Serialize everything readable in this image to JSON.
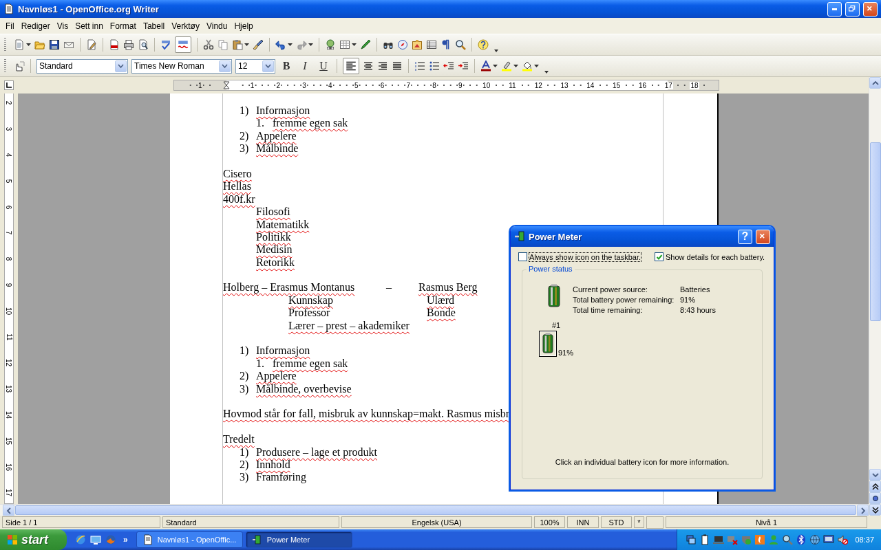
{
  "window": {
    "title": "Navnløs1 - OpenOffice.org Writer"
  },
  "menu": [
    "Fil",
    "Rediger",
    "Vis",
    "Sett inn",
    "Format",
    "Tabell",
    "Verktøy",
    "Vindu",
    "Hjelp"
  ],
  "standard_bar": {
    "auto_spellcheck": true
  },
  "format_bar": {
    "paragraph_style": "Standard",
    "font": "Times New Roman",
    "size": "12",
    "bold": "B",
    "italic": "I",
    "underline": "U",
    "align": [
      {
        "selected": true
      },
      {
        "selected": false
      },
      {
        "selected": false
      },
      {
        "selected": false
      }
    ]
  },
  "ruler": {
    "marks": [
      "1",
      "1",
      "2",
      "3",
      "4",
      "5",
      "6",
      "7",
      "8",
      "9",
      "10",
      "11",
      "12",
      "13",
      "14",
      "15",
      "16",
      "17",
      "18"
    ]
  },
  "vertical_ruler": {
    "marks": [
      "2",
      "3",
      "4",
      "5",
      "6",
      "7",
      "8",
      "9",
      "10",
      "11",
      "12",
      "13",
      "14",
      "15",
      "16",
      "17"
    ]
  },
  "document": {
    "lines": [
      {
        "kind": "numbered",
        "marker": "1)",
        "text": "Informasjon",
        "flagged": true
      },
      {
        "kind": "sub",
        "marker": "1.",
        "text": "fremme egen sak",
        "flagged": true
      },
      {
        "kind": "numbered",
        "marker": "2)",
        "text": "Appelere",
        "flagged": true
      },
      {
        "kind": "numbered",
        "marker": "3)",
        "text": "Målbinde",
        "flagged": true
      },
      {
        "kind": "blank"
      },
      {
        "kind": "text",
        "text": "Cisero",
        "flagged": true
      },
      {
        "kind": "text",
        "text": "Hellas",
        "flagged": true
      },
      {
        "kind": "text",
        "text": "400f.kr",
        "flagged": true
      },
      {
        "kind": "indent",
        "text": "Filosofi",
        "flagged": true
      },
      {
        "kind": "indent",
        "text": "Matematikk",
        "flagged": true
      },
      {
        "kind": "indent",
        "text": "Politikk",
        "flagged": true
      },
      {
        "kind": "indent",
        "text": "Medisin",
        "flagged": true
      },
      {
        "kind": "indent",
        "text": "Retorikk",
        "flagged": true
      },
      {
        "kind": "blank"
      },
      {
        "kind": "columns",
        "cells": [
          {
            "text": "Holberg – Erasmus Montanus",
            "flagged": true
          },
          {
            "text": "–"
          },
          {
            "text": "Rasmus Berg",
            "flagged": true
          }
        ]
      },
      {
        "kind": "pair",
        "cells": [
          {
            "text": "Kunnskap",
            "flagged": true
          },
          {
            "text": "Ulærd",
            "flagged": true
          }
        ]
      },
      {
        "kind": "pair",
        "cells": [
          {
            "text": "Professor",
            "flagged": false
          },
          {
            "text": "Bonde",
            "flagged": true
          }
        ]
      },
      {
        "kind": "indent2",
        "text": "Lærer – prest – akademiker",
        "flagged": true
      },
      {
        "kind": "blank"
      },
      {
        "kind": "numbered",
        "marker": "1)",
        "text": "Informasjon",
        "flagged": true
      },
      {
        "kind": "sub",
        "marker": "1.",
        "text": "fremme egen sak",
        "flagged": true
      },
      {
        "kind": "numbered",
        "marker": "2)",
        "text": "Appelere",
        "flagged": true
      },
      {
        "kind": "numbered",
        "marker": "3)",
        "text": "Målbinde, overbevise",
        "flagged": true
      },
      {
        "kind": "blank"
      },
      {
        "kind": "text",
        "text": "Hovmod står for fall, misbruk av kunnskap=makt. Rasmus misbr",
        "flagged": true
      },
      {
        "kind": "blank"
      },
      {
        "kind": "text",
        "text": "Tredelt",
        "flagged": true
      },
      {
        "kind": "numbered",
        "marker": "1)",
        "text": "Produsere – lage et produkt",
        "flagged": true
      },
      {
        "kind": "numbered",
        "marker": "2)",
        "text": "Innhold",
        "flagged": true
      },
      {
        "kind": "numbered",
        "marker": "3)",
        "text": "Framføring",
        "flagged": false
      }
    ]
  },
  "status_bar": [
    "Side 1 / 1",
    "Standard",
    "Engelsk (USA)",
    "100%",
    "INN",
    "STD",
    "*",
    "Nivå 1"
  ],
  "taskbar": {
    "start": "start",
    "more": "»",
    "tasks": [
      {
        "label": "Navnløs1 - OpenOffic...",
        "selected": false
      },
      {
        "label": "Power Meter",
        "selected": true
      }
    ],
    "clock": "08:37"
  },
  "dialog": {
    "title": "Power Meter",
    "help": "?",
    "options": [
      {
        "label": "Always show icon on the taskbar.",
        "checked": false,
        "focused": true
      },
      {
        "label": "Show details for each battery.",
        "checked": true,
        "focused": false
      }
    ],
    "group": "Power status",
    "fields": [
      {
        "label": "Current power source:",
        "value": "Batteries"
      },
      {
        "label": "Total battery power remaining:",
        "value": "91%"
      },
      {
        "label": "Total time remaining:",
        "value": "8:43 hours"
      }
    ],
    "batteries": [
      {
        "label": "#1",
        "reading": "91%",
        "selected": true
      }
    ],
    "hint": "Click an individual battery icon for more information."
  }
}
